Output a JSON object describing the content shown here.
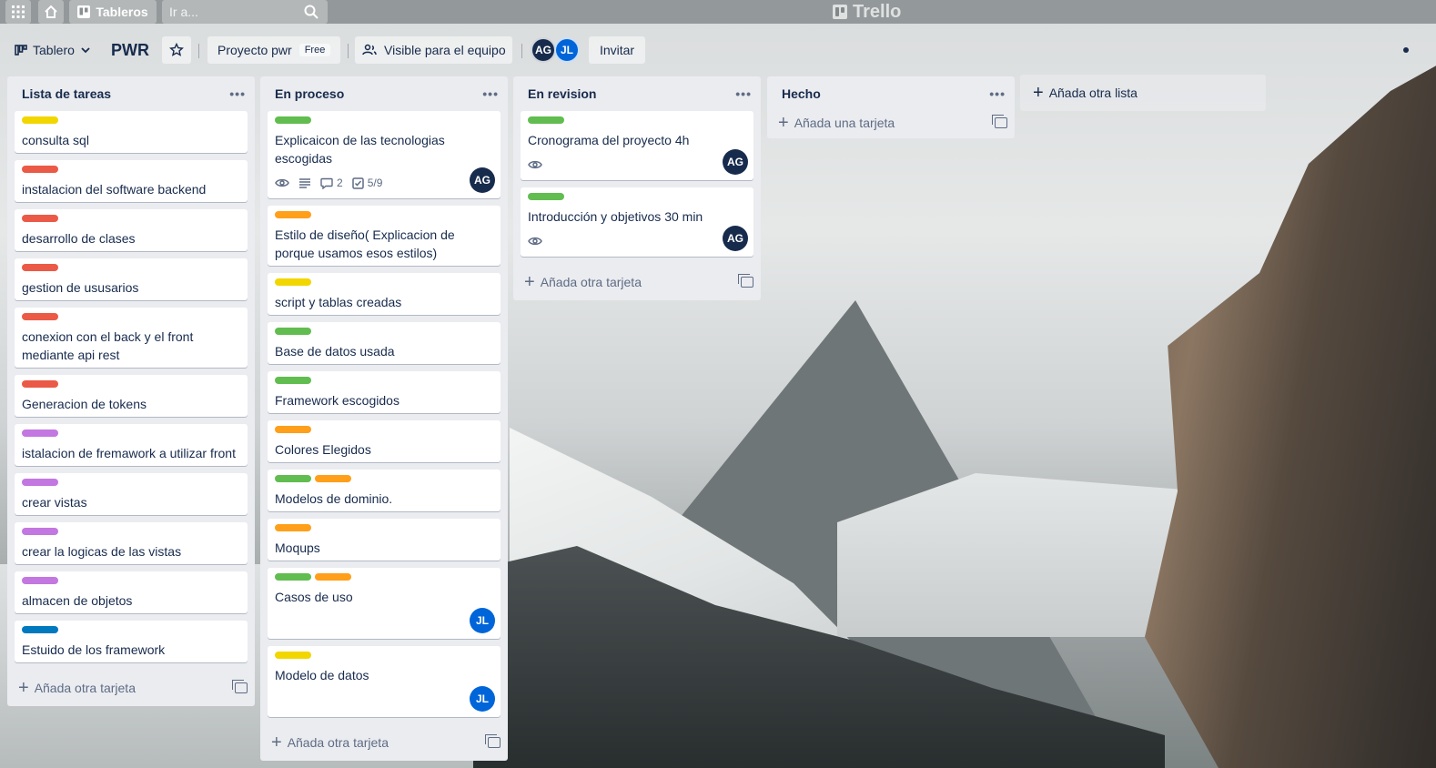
{
  "topbar": {
    "boards_label": "Tableros",
    "search_placeholder": "Ir a...",
    "logo_text": "Trello"
  },
  "board_header": {
    "view_label": "Tablero",
    "board_title": "PWR",
    "project_label": "Proyecto pwr",
    "project_plan": "Free",
    "visibility_label": "Visible para el equipo",
    "members": [
      {
        "initials": "AG",
        "color": "#172b4d"
      },
      {
        "initials": "JL",
        "color": "#0065d9"
      }
    ],
    "invite_label": "Invitar"
  },
  "label_colors": {
    "yellow": "#f2d600",
    "red": "#eb5a46",
    "purple": "#c377e0",
    "blue": "#0079bf",
    "green": "#61bd4f",
    "orange": "#ff9f1a"
  },
  "lists": [
    {
      "title": "Lista de tareas",
      "footer": "Añada otra tarjeta",
      "cards": [
        {
          "title": "consulta sql",
          "labels": [
            "yellow"
          ]
        },
        {
          "title": "instalacion del software backend",
          "labels": [
            "red"
          ]
        },
        {
          "title": "desarrollo de clases",
          "labels": [
            "red"
          ]
        },
        {
          "title": "gestion de ususarios",
          "labels": [
            "red"
          ]
        },
        {
          "title": "conexion con el back y el front mediante api rest",
          "labels": [
            "red"
          ]
        },
        {
          "title": "Generacion de tokens",
          "labels": [
            "red"
          ]
        },
        {
          "title": "istalacion de fremawork a utilizar front",
          "labels": [
            "purple"
          ]
        },
        {
          "title": "crear vistas",
          "labels": [
            "purple"
          ]
        },
        {
          "title": "crear la logicas de las vistas",
          "labels": [
            "purple"
          ]
        },
        {
          "title": "almacen de objetos",
          "labels": [
            "purple"
          ]
        },
        {
          "title": "Estuido de los framework",
          "labels": [
            "blue"
          ]
        }
      ]
    },
    {
      "title": "En proceso",
      "footer": "Añada otra tarjeta",
      "cards": [
        {
          "title": "Explicaicon de las tecnologias escogidas",
          "labels": [
            "green"
          ],
          "badges": {
            "comments": "2",
            "checklist": "5/9"
          },
          "member": "AG"
        },
        {
          "title": "Estilo de diseño( Explicacion de porque usamos esos estilos)",
          "labels": [
            "orange"
          ]
        },
        {
          "title": "script y tablas creadas",
          "labels": [
            "yellow"
          ]
        },
        {
          "title": "Base de datos usada",
          "labels": [
            "green"
          ]
        },
        {
          "title": "Framework escogidos",
          "labels": [
            "green"
          ]
        },
        {
          "title": "Colores Elegidos",
          "labels": [
            "orange"
          ]
        },
        {
          "title": "Modelos de dominio.",
          "labels": [
            "green",
            "orange"
          ]
        },
        {
          "title": "Moqups",
          "labels": [
            "orange"
          ]
        },
        {
          "title": "Casos de uso",
          "labels": [
            "green",
            "orange"
          ],
          "member": "JL"
        },
        {
          "title": "Modelo de datos",
          "labels": [
            "yellow"
          ],
          "member": "JL"
        }
      ]
    },
    {
      "title": "En revision",
      "footer": "Añada otra tarjeta",
      "cards": [
        {
          "title": "Cronograma del proyecto 4h",
          "labels": [
            "green"
          ],
          "badges": {
            "watch": true
          },
          "member": "AG"
        },
        {
          "title": "Introducción y objetivos 30 min",
          "labels": [
            "green"
          ],
          "badges": {
            "watch": true
          },
          "member": "AG"
        }
      ]
    },
    {
      "title": "Hecho",
      "footer": "Añada una tarjeta",
      "cards": []
    }
  ],
  "add_list_label": "Añada otra lista"
}
